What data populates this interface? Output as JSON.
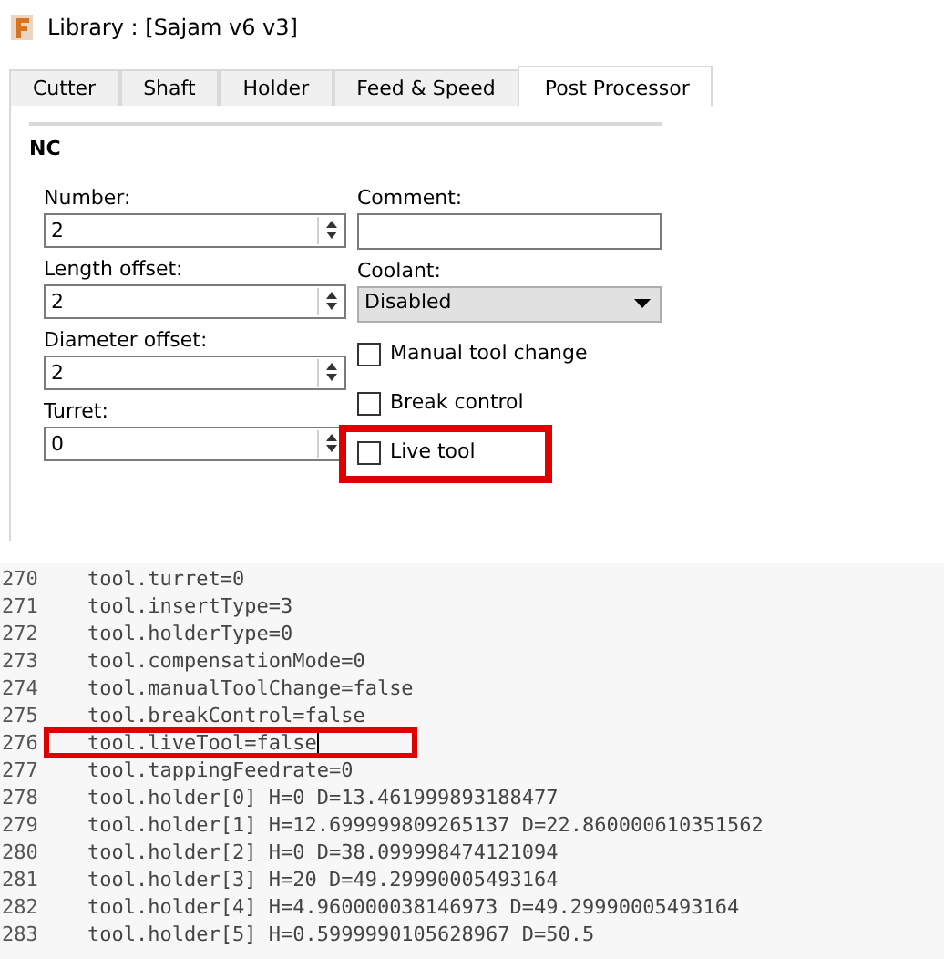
{
  "window": {
    "title": "Library :  [Sajam v6 v3]"
  },
  "tabs": [
    {
      "label": "Cutter",
      "selected": false
    },
    {
      "label": "Shaft",
      "selected": false
    },
    {
      "label": "Holder",
      "selected": false
    },
    {
      "label": "Feed & Speed",
      "selected": false
    },
    {
      "label": "Post Processor",
      "selected": true
    }
  ],
  "section": "NC",
  "left_fields": [
    {
      "label": "Number:",
      "value": "2"
    },
    {
      "label": "Length offset:",
      "value": "2"
    },
    {
      "label": "Diameter offset:",
      "value": "2"
    },
    {
      "label": "Turret:",
      "value": "0"
    }
  ],
  "comment": {
    "label": "Comment:"
  },
  "coolant": {
    "label": "Coolant:",
    "value": "Disabled"
  },
  "checkboxes": [
    {
      "label": "Manual tool change",
      "checked": false,
      "highlighted": false
    },
    {
      "label": "Break control",
      "checked": false,
      "highlighted": false
    },
    {
      "label": "Live tool",
      "checked": false,
      "highlighted": true
    }
  ],
  "code_lines": [
    {
      "number": "270",
      "text": "tool.turret=0",
      "highlighted": false,
      "cursor": false
    },
    {
      "number": "271",
      "text": "tool.insertType=3",
      "highlighted": false,
      "cursor": false
    },
    {
      "number": "272",
      "text": "tool.holderType=0",
      "highlighted": false,
      "cursor": false
    },
    {
      "number": "273",
      "text": "tool.compensationMode=0",
      "highlighted": false,
      "cursor": false
    },
    {
      "number": "274",
      "text": "tool.manualToolChange=false",
      "highlighted": false,
      "cursor": false
    },
    {
      "number": "275",
      "text": "tool.breakControl=false",
      "highlighted": false,
      "cursor": false
    },
    {
      "number": "276",
      "text": "tool.liveTool=false",
      "highlighted": true,
      "cursor": true
    },
    {
      "number": "277",
      "text": "tool.tappingFeedrate=0",
      "highlighted": false,
      "cursor": false
    },
    {
      "number": "278",
      "text": "tool.holder[0] H=0 D=13.461999893188477",
      "highlighted": false,
      "cursor": false
    },
    {
      "number": "279",
      "text": "tool.holder[1] H=12.699999809265137 D=22.860000610351562",
      "highlighted": false,
      "cursor": false
    },
    {
      "number": "280",
      "text": "tool.holder[2] H=0 D=38.099998474121094",
      "highlighted": false,
      "cursor": false
    },
    {
      "number": "281",
      "text": "tool.holder[3] H=20 D=49.29990005493164",
      "highlighted": false,
      "cursor": false
    },
    {
      "number": "282",
      "text": "tool.holder[4] H=4.960000038146973 D=49.29990005493164",
      "highlighted": false,
      "cursor": false
    },
    {
      "number": "283",
      "text": "tool.holder[5] H=0.5999990105628967 D=50.5",
      "highlighted": false,
      "cursor": false
    }
  ]
}
